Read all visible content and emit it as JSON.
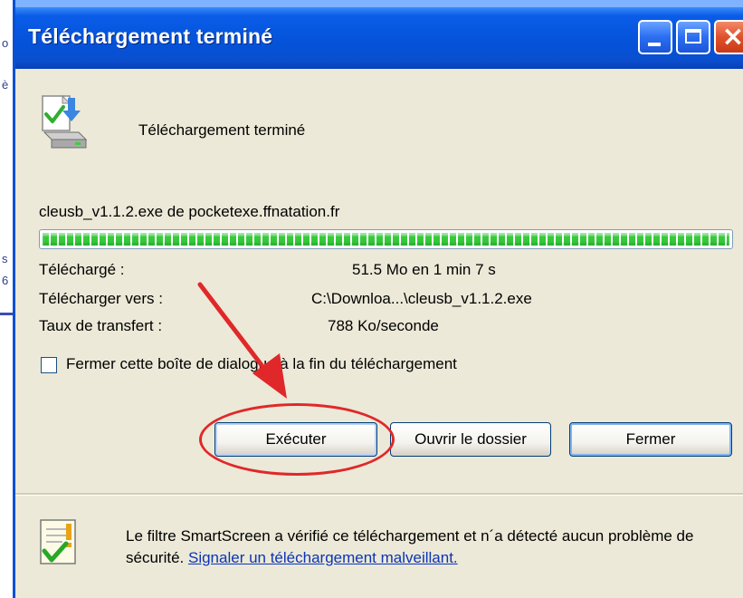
{
  "window": {
    "title": "Téléchargement terminé",
    "accent": "#0a5ce8",
    "close_color": "#e0512a"
  },
  "header": {
    "icon": "download-complete-icon",
    "text": "Téléchargement terminé"
  },
  "download": {
    "filename_line": "cleusb_v1.1.2.exe de pocketexe.ffnatation.fr",
    "progress_fraction": 1.0,
    "progress_color": "#35c93a",
    "info": [
      {
        "label": "Téléchargé :",
        "value": "51.5 Mo en 1 min 7 s"
      },
      {
        "label": "Télécharger vers :",
        "value": "C:\\Downloa...\\cleusb_v1.1.2.exe"
      },
      {
        "label": "Taux de transfert :",
        "value": "788 Ko/seconde"
      }
    ]
  },
  "checkbox": {
    "label": "Fermer cette boîte de dialogue à la fin du téléchargement",
    "checked": false
  },
  "buttons": {
    "run": "Exécuter",
    "open_folder": "Ouvrir le dossier",
    "close": "Fermer"
  },
  "annotation": {
    "color": "#e0282a"
  },
  "footer": {
    "icon": "smartscreen-shield-icon",
    "text": "Le filtre SmartScreen a vérifié ce téléchargement et n´a détecté aucun problème de sécurité.",
    "link": "Signaler un téléchargement malveillant."
  }
}
